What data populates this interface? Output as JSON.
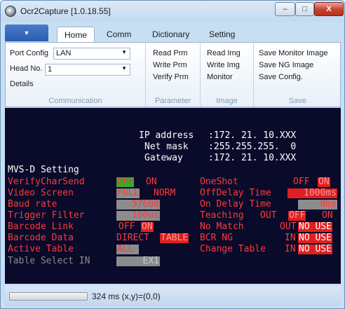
{
  "window": {
    "title": "Ocr2Capture [1.0.18.55]",
    "min": "–",
    "max": "□",
    "close": "X"
  },
  "ribbon": {
    "file_tab": "▼",
    "tabs": [
      "Home",
      "Comm",
      "Dictionary",
      "Setting"
    ],
    "communication": {
      "port_label": "Port Config",
      "port_value": "LAN",
      "head_label": "Head No.",
      "head_value": "1",
      "details": "Details",
      "group": "Communication"
    },
    "parameter": {
      "read": "Read Prm",
      "write": "Write Prm",
      "verify": "Verify Prm",
      "group": "Parameter"
    },
    "image": {
      "read": "Read Img",
      "write": "Write Img",
      "monitor": "Monitor",
      "group": "Image"
    },
    "save": {
      "monitor": "Save Monitor Image",
      "ng": "Save NG Image",
      "config": "Save Config.",
      "group": "Save"
    }
  },
  "network": {
    "ip_label": "IP address",
    "ip_value": ":172. 21. 10.XXX",
    "mask_label": "Net mask",
    "mask_value": ":255.255.255.  0",
    "gw_label": "Gateway",
    "gw_value": ":172. 21. 10.XXX"
  },
  "setting": {
    "title": "MVS-D Setting",
    "verify_label": "VerifyCharSend",
    "verify_off": "OFF",
    "verify_on": "ON",
    "video_label": "Video Screen",
    "video_full": "FULL",
    "video_norm": "NORM",
    "baud_label": "Baud rate",
    "baud_value": "57600",
    "trigger_label": "Trigger Filter",
    "trigger_value": "100us",
    "barcode_link_label": "Barcode Link",
    "barcode_link_off": "OFF",
    "barcode_link_on": "ON",
    "barcode_data_label": "Barcode Data",
    "barcode_data_direct": "DIRECT",
    "barcode_data_table": "TABLE",
    "active_table_label": "Active Table",
    "active_table_value": "ALL",
    "table_select_label": "Table Select IN",
    "table_select_value": "EX1",
    "oneshot_label": "OneShot",
    "oneshot_off": "OFF",
    "oneshot_on": "ON",
    "offdelay_label": "OffDelay Time",
    "offdelay_value": "1000ms",
    "ondelay_label": "On Delay Time",
    "ondelay_value": "0ms",
    "teaching_label": "Teaching",
    "teaching_out": "OUT",
    "teaching_off": "OFF",
    "teaching_on": "ON",
    "nomatch_label": "No Match",
    "nomatch_out": "OUT",
    "nomatch_value": "NO USE",
    "bcrng_label": "BCR NG",
    "bcrng_in": "IN",
    "bcrng_value": "NO USE",
    "changetable_label": "Change Table",
    "changetable_in": "IN",
    "changetable_value": "NO USE"
  },
  "status": {
    "progress": 0,
    "text": "324 ms (x,y)=(0,0)"
  }
}
